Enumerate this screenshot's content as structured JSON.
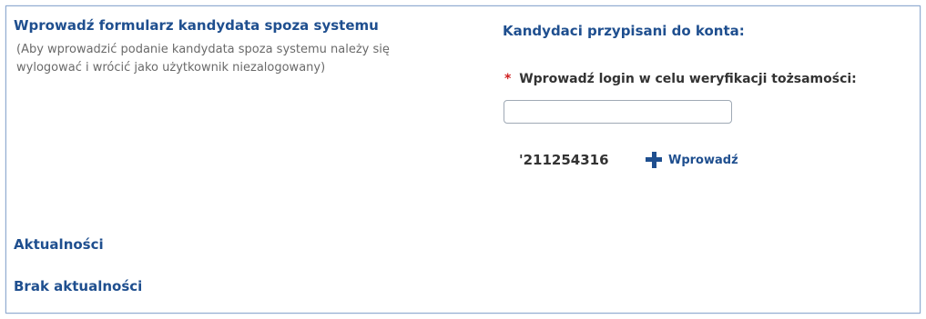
{
  "left_panel": {
    "form_link_label": "Wprowadź formularz kandydata spoza systemu",
    "form_note": "(Aby wprowadzić podanie kandydata spoza systemu należy się wylogować i wrócić jako użytkownik niezalogowany)",
    "news_heading": "Aktualności",
    "no_news_text": "Brak aktualności"
  },
  "right_panel": {
    "heading": "Kandydaci przypisani do konta:",
    "login_label": "Wprowadź login w celu weryfikacji tożsamości:",
    "required_marker": "*",
    "login_input_value": "",
    "code_value": "'211254316",
    "add_icon": "plus-icon",
    "add_link_label": "Wprowadź"
  },
  "colors": {
    "link": "#1f4f8f",
    "required": "#d02020",
    "note_text": "#6a6a6a",
    "frame_border": "#8ea9cf"
  }
}
